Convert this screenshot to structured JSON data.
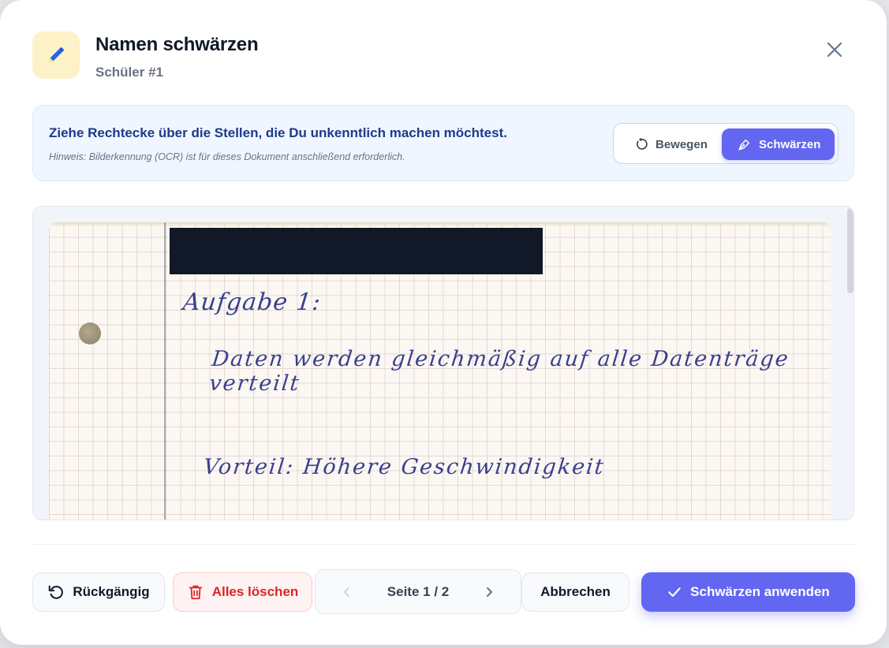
{
  "dialog": {
    "title": "Namen schwärzen",
    "subtitle": "Schüler #1",
    "header_icon": "pencil-icon",
    "accent_color": "#6366f1"
  },
  "instructions": {
    "main": "Ziehe Rechtecke über die Stellen, die Du unkenntlich machen möchtest.",
    "hint": "Hinweis: Bilderkennung (OCR) ist für dieses Dokument anschließend erforderlich."
  },
  "mode_toggle": {
    "move_label": "Bewegen",
    "redact_label": "Schwärzen",
    "active": "Schwärzen"
  },
  "document": {
    "handwriting": [
      "Aufgabe 1:",
      "Daten werden gleichmäßig auf alle Datenträge verteilt",
      "Vorteil: Höhere Geschwindigkeit"
    ]
  },
  "footer": {
    "undo_label": "Rückgängig",
    "clear_label": "Alles löschen",
    "page_label": "Seite 1 / 2",
    "cancel_label": "Abbrechen",
    "apply_label": "Schwärzen anwenden"
  }
}
